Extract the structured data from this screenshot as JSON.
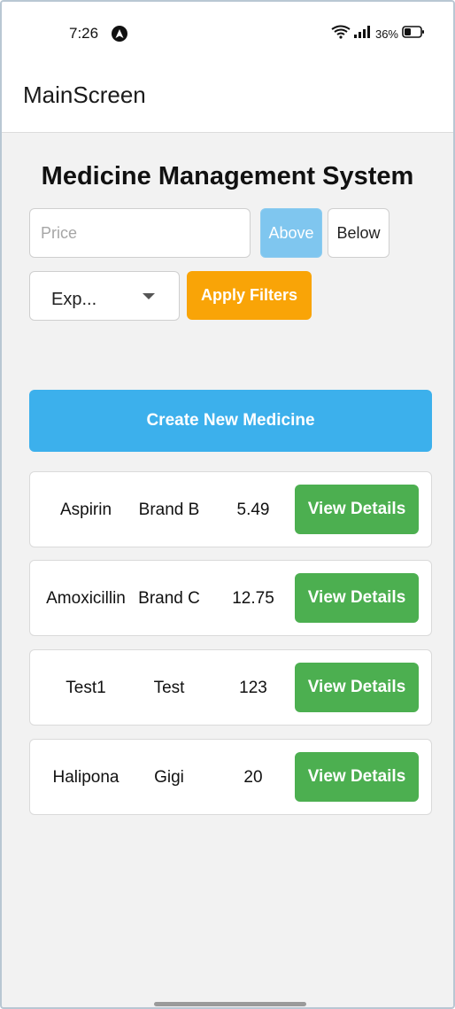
{
  "status_bar": {
    "time": "7:26",
    "battery_percent": "36%",
    "icons": [
      "navigation-icon",
      "wifi-icon",
      "signal-icon",
      "battery-icon"
    ]
  },
  "app_bar": {
    "title": "MainScreen"
  },
  "page": {
    "title": "Medicine Management System"
  },
  "filters": {
    "price_placeholder": "Price",
    "price_value": "",
    "above_label": "Above",
    "below_label": "Below",
    "selected_mode": "Above",
    "dropdown_selected": "Exp...",
    "apply_label": "Apply Filters"
  },
  "create_button_label": "Create New Medicine",
  "medicines": [
    {
      "name": "Aspirin",
      "brand": "Brand B",
      "price": "5.49",
      "action": "View Details"
    },
    {
      "name": "Amoxicillin",
      "brand": "Brand C",
      "price": "12.75",
      "action": "View Details"
    },
    {
      "name": "Test1",
      "brand": "Test",
      "price": "123",
      "action": "View Details"
    },
    {
      "name": "Halipona",
      "brand": "Gigi",
      "price": "20",
      "action": "View Details"
    }
  ],
  "colors": {
    "above_active": "#7fc6ef",
    "apply": "#f9a407",
    "create": "#3cb0ec",
    "view_details": "#4caf50",
    "background": "#f2f2f2"
  }
}
